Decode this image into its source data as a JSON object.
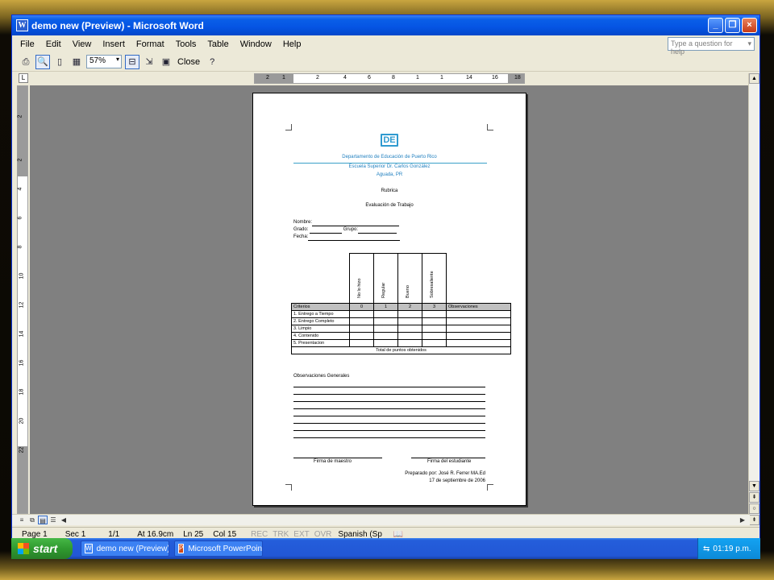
{
  "window": {
    "title": "demo new (Preview) - Microsoft Word",
    "app_icon": "W",
    "controls": [
      "_",
      "❐",
      "×"
    ]
  },
  "menu": {
    "items": [
      "File",
      "Edit",
      "View",
      "Insert",
      "Format",
      "Tools",
      "Table",
      "Window",
      "Help"
    ],
    "help_placeholder": "Type a question for help"
  },
  "toolbar": {
    "zoom": "57%",
    "close_label": "Close"
  },
  "ruler": {
    "h_ticks": [
      "2",
      "1",
      "2",
      "4",
      "6",
      "8",
      "1",
      "1",
      "14",
      "16",
      "18"
    ],
    "v_ticks": [
      "2",
      "2",
      "4",
      "6",
      "8",
      "10",
      "12",
      "14",
      "16",
      "18",
      "20",
      "22"
    ]
  },
  "document": {
    "logo": "DE",
    "header_line1": "Departamento de Educación de Puerto Rico",
    "header_line2": "Escuela Superior Dr. Carlos González",
    "header_line3": "Aguada, PR",
    "title": "Rubrica",
    "subtitle": "Evaluación de Trabajo",
    "field_nombre": "Nombre:",
    "field_grado": "Grado:",
    "field_grupo": "Grupo:",
    "field_fecha": "Fecha:",
    "rubric": {
      "levels": [
        "No lo hizo",
        "Regular",
        "Bueno",
        "Sobresaliente"
      ],
      "criteria_header": "Criterios",
      "scores": [
        "0",
        "1",
        "2",
        "3"
      ],
      "observations_header": "Observaciones",
      "criteria": [
        "1. Entrego a Tiempo",
        "2. Entrego Completo",
        "3. Limpio",
        "4. Contenido",
        "5. Presentacion"
      ],
      "total_label": "Total de puntos obtenidos"
    },
    "obs_general": "Observaciones Generales",
    "sig_teacher": "Firma de maestro",
    "sig_student": "Firma del estudiante",
    "prepared_by": "Preparado por: José R. Ferrer MA.Ed",
    "date": "17 de septiembre de 2006"
  },
  "status": {
    "page": "Page 1",
    "sec": "Sec 1",
    "pages": "1/1",
    "at": "At 16.9cm",
    "ln": "Ln 25",
    "col": "Col 15",
    "rec": "REC",
    "trk": "TRK",
    "ext": "EXT",
    "ovr": "OVR",
    "language": "Spanish (Sp"
  },
  "taskbar": {
    "start": "start",
    "tasks": [
      "demo new (Preview) ...",
      "Microsoft PowerPoint ..."
    ],
    "clock": "01:19 p.m."
  }
}
